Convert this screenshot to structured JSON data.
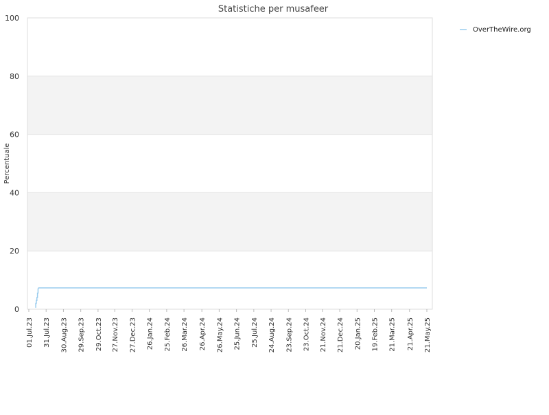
{
  "chart_data": {
    "type": "line",
    "title": "Statistiche per musafeer",
    "xlabel": "",
    "ylabel": "Percentuale",
    "ylim": [
      0,
      100
    ],
    "yticks": [
      0,
      20,
      40,
      60,
      80,
      100
    ],
    "xlim": [
      "2023-07-01",
      "2025-05-28"
    ],
    "xtick_dates": [
      "2023-07-01",
      "2023-07-31",
      "2023-08-30",
      "2023-09-29",
      "2023-10-29",
      "2023-11-27",
      "2023-12-27",
      "2024-01-26",
      "2024-02-25",
      "2024-03-26",
      "2024-04-26",
      "2024-05-26",
      "2024-06-25",
      "2024-07-25",
      "2024-08-24",
      "2024-09-23",
      "2024-10-23",
      "2024-11-21",
      "2024-12-21",
      "2025-01-20",
      "2025-02-19",
      "2025-03-21",
      "2025-04-21",
      "2025-05-21"
    ],
    "xtick_labels": [
      "01.Jul.23",
      "31.Jul.23",
      "30.Aug.23",
      "29.Sep.23",
      "29.Oct.23",
      "27.Nov.23",
      "27.Dec.23",
      "26.Jan.24",
      "25.Feb.24",
      "26.Mar.24",
      "26.Apr.24",
      "26.May.24",
      "25.Jun.24",
      "25.Jul.24",
      "24.Aug.24",
      "23.Sep.24",
      "23.Oct.24",
      "21.Nov.24",
      "21.Dec.24",
      "20.Jan.25",
      "19.Feb.25",
      "21.Mar.25",
      "21.Apr.25",
      "21.May.25"
    ],
    "grid": true,
    "legend": "top-right",
    "band_color": "#f3f3f3",
    "series": [
      {
        "name": "OverTheWire.org",
        "color": "#99ccee",
        "x": [
          "2023-07-13",
          "2023-07-13",
          "2023-07-14",
          "2023-07-14",
          "2023-07-15",
          "2023-07-15",
          "2023-07-16",
          "2023-07-16",
          "2023-07-17",
          "2023-07-17",
          "2023-07-18",
          "2025-05-28"
        ],
        "y": [
          0.5,
          2.0,
          2.0,
          3.0,
          3.0,
          4.0,
          4.0,
          5.5,
          5.5,
          7.0,
          7.3,
          7.3
        ]
      }
    ]
  }
}
